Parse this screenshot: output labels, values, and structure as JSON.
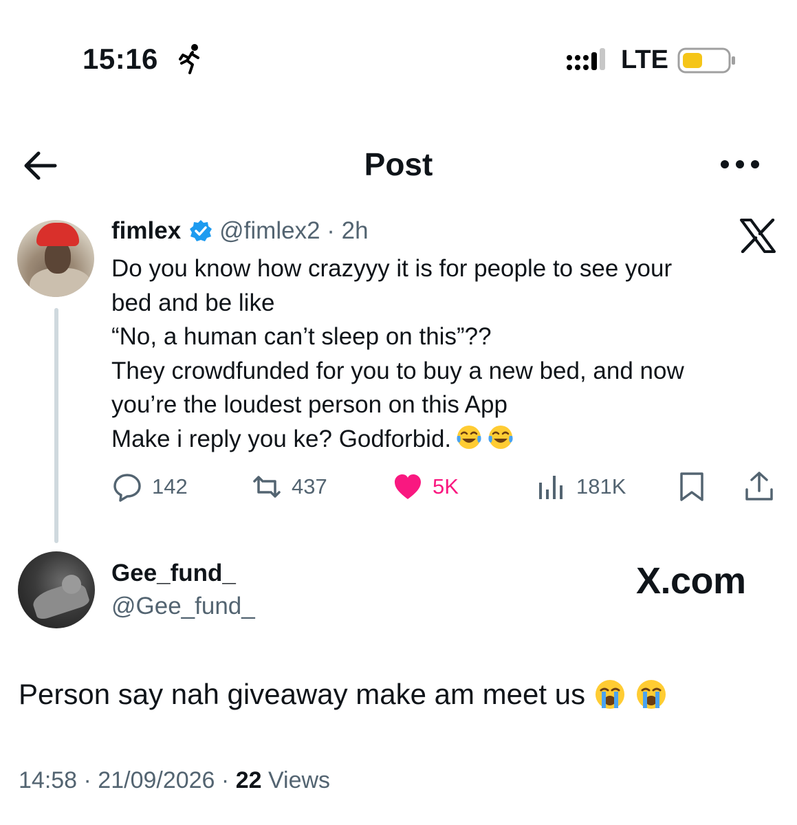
{
  "status_bar": {
    "time": "15:16",
    "network": "LTE",
    "battery_color": "#f5c518"
  },
  "header": {
    "title": "Post"
  },
  "quoted_post": {
    "display_name": "fimlex",
    "handle_time": "@fimlex2 · 2h",
    "lines": [
      "Do you know how crazyyy it is for people to see your",
      "bed and be like",
      "“No, a human can’t sleep on this”??",
      "They crowdfunded for you to buy a new bed, and now",
      "you’re the loudest person on this App",
      "Make i reply you ke?  Godforbid."
    ],
    "trailing_emoji": [
      "face-with-tears-of-joy",
      "face-with-tears-of-joy"
    ],
    "stats": {
      "replies": "142",
      "reposts": "437",
      "likes": "5K",
      "views": "181K"
    },
    "colors": {
      "like": "#f91880",
      "verified": "#1d9bf0"
    }
  },
  "reply": {
    "display_name": "Gee_fund_",
    "handle": "@Gee_fund_",
    "brand": "X.com",
    "text": "Person say nah giveaway make am meet us",
    "trailing_emoji": [
      "loudly-crying-face",
      "loudly-crying-face"
    ]
  },
  "meta": {
    "time_date": "14:58 · 21/09/2026 · ",
    "views_count": "22",
    "views_label": " Views"
  }
}
